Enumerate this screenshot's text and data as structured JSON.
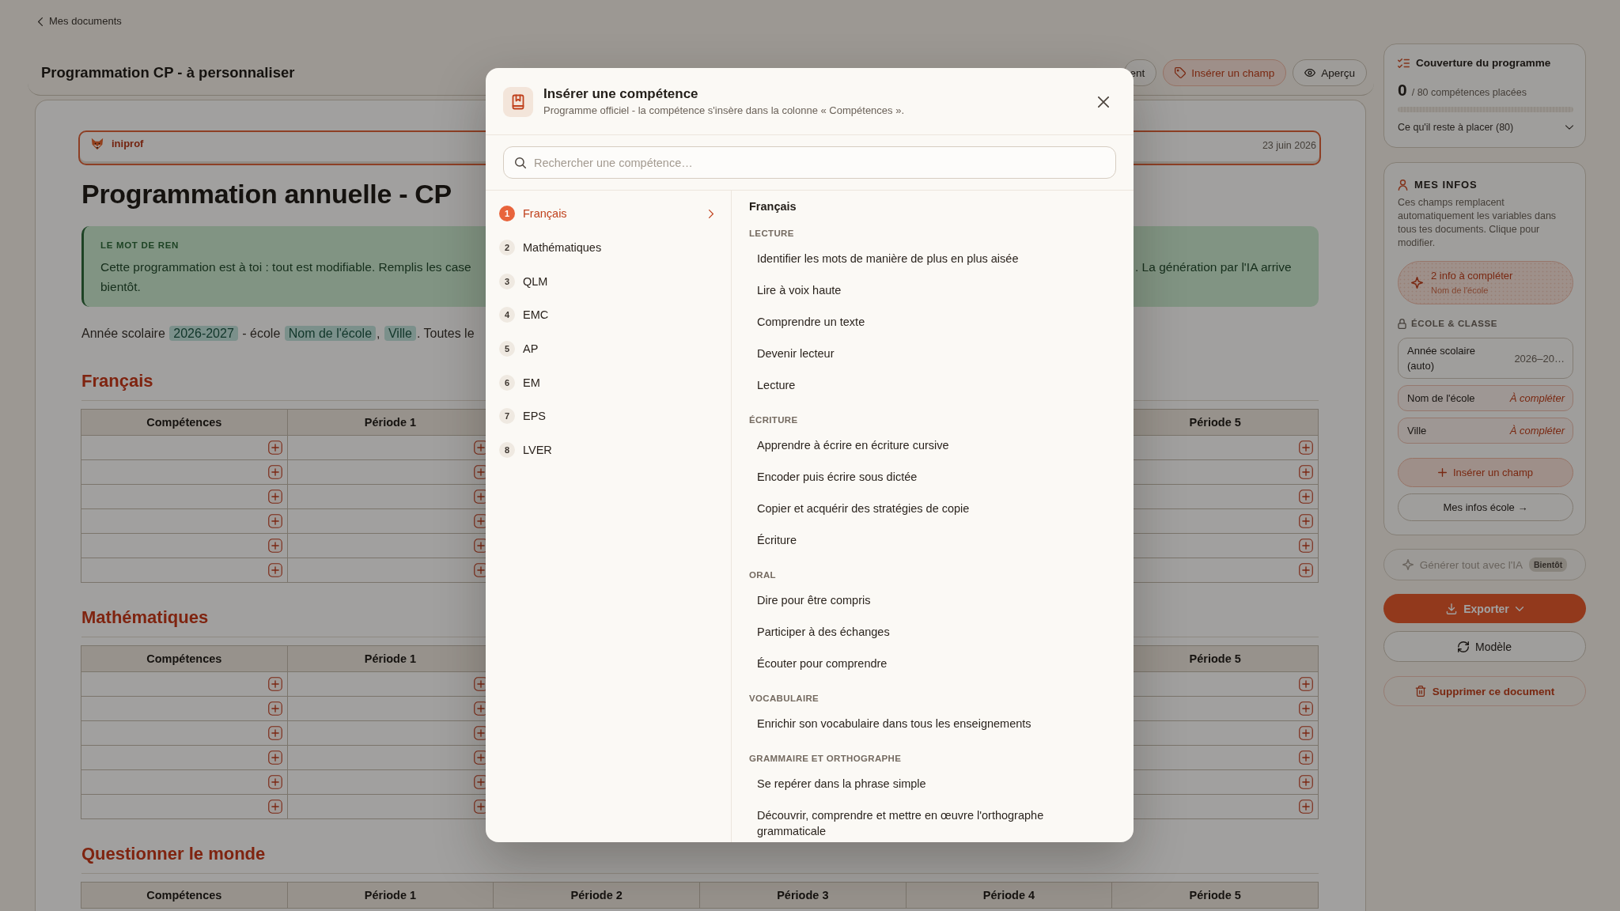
{
  "back_link": "Mes documents",
  "header": {
    "title": "Programmation CP - à personnaliser",
    "buttons": [
      {
        "label": "ent",
        "kind": "outline"
      },
      {
        "label": "Insérer un champ",
        "kind": "accent"
      },
      {
        "label": "Aperçu",
        "kind": "outline"
      }
    ]
  },
  "document": {
    "brand": "iniprof",
    "date": "23 juin 2026",
    "title": "Programmation annuelle - CP",
    "callout": {
      "label": "LE MOT DE REN",
      "text_lines": [
        "Cette programmation est à toi : tout est modifiable. Remplis les case",
        "bientôt."
      ],
      "text_past_dialog": ". La génération par l'IA arrive"
    },
    "intro": [
      {
        "kind": "text",
        "text": "Année scolaire "
      },
      {
        "kind": "variable",
        "text": "2026-2027"
      },
      {
        "kind": "text",
        "text": " - école "
      },
      {
        "kind": "variable",
        "text": "Nom de l'école"
      },
      {
        "kind": "text",
        "text": ", "
      },
      {
        "kind": "variable",
        "text": "Ville"
      },
      {
        "kind": "text",
        "text": ". Toutes le"
      }
    ],
    "sections": [
      {
        "title": "Français",
        "columns": [
          "Compétences",
          "Période 1"
        ],
        "columns_past_dialog": [
          "Période 5"
        ],
        "rows": [
          {},
          {},
          {},
          {},
          {},
          {}
        ]
      },
      {
        "title": "Mathématiques",
        "columns": [
          "Compétences",
          "Période 1"
        ],
        "columns_past_dialog": [
          "Période 5"
        ],
        "rows": [
          {},
          {},
          {},
          {},
          {},
          {}
        ]
      },
      {
        "title": "Questionner le monde",
        "columns": [
          "Compétences",
          "Période 1",
          "Période 2",
          "Période 3",
          "Période 4",
          "Période 5"
        ]
      }
    ]
  },
  "dialog": {
    "title": "Insérer une compétence",
    "subtitle": "Programme officiel - la compétence s'insère dans la colonne « Compétences ».",
    "search": {
      "placeholder": "Rechercher une compétence…"
    },
    "subjects": [
      {
        "number": "1",
        "label": "Français",
        "selected": true
      },
      {
        "number": "2",
        "label": "Mathématiques",
        "selected": false
      },
      {
        "number": "3",
        "label": "QLM",
        "selected": false
      },
      {
        "number": "4",
        "label": "EMC",
        "selected": false
      },
      {
        "number": "5",
        "label": "AP",
        "selected": false
      },
      {
        "number": "6",
        "label": "EM",
        "selected": false
      },
      {
        "number": "7",
        "label": "EPS",
        "selected": false
      },
      {
        "number": "8",
        "label": "LVER",
        "selected": false
      }
    ],
    "heading": "Français",
    "groups": [
      {
        "title": "LECTURE",
        "items": [
          "Identifier les mots de manière de plus en plus aisée",
          "Lire à voix haute",
          "Comprendre un texte",
          "Devenir lecteur",
          "Lecture"
        ]
      },
      {
        "title": "ÉCRITURE",
        "items": [
          "Apprendre à écrire en écriture cursive",
          "Encoder puis écrire sous dictée",
          "Copier et acquérir des stratégies de copie",
          "Écriture"
        ]
      },
      {
        "title": "ORAL",
        "items": [
          "Dire pour être compris",
          "Participer à des échanges",
          "Écouter pour comprendre"
        ]
      },
      {
        "title": "VOCABULAIRE",
        "items": [
          "Enrichir son vocabulaire dans tous les enseignements"
        ]
      },
      {
        "title": "GRAMMAIRE ET ORTHOGRAPHE",
        "items": [
          "Se repérer dans la phrase simple",
          "Découvrir, comprendre et mettre en œuvre l'orthographe grammaticale"
        ]
      }
    ]
  },
  "sidebar": {
    "coverage": {
      "title": "Couverture du programme",
      "count": "0",
      "count_label": "/ 80 compétences placées",
      "level": 0,
      "remaining": "Ce qu'il reste à placer (80)",
      "expanded": false
    },
    "my_info": {
      "title": "MES INFOS",
      "description": "Ces champs remplacent automatiquement les variables dans tous tes documents. Clique pour modifier.",
      "alert": {
        "title": "2 info à compléter",
        "detail": "Nom de l'école"
      },
      "group": "ÉCOLE & CLASSE",
      "fields": [
        {
          "label": "Année scolaire (auto)",
          "value": "2026–20…",
          "missing": false
        },
        {
          "label": "Nom de l'école",
          "value": "À compléter",
          "missing": true
        },
        {
          "label": "Ville",
          "value": "À compléter",
          "missing": true
        }
      ],
      "buttons": [
        {
          "label": "Insérer un champ",
          "kind": "accent"
        },
        {
          "label": "Mes infos école →",
          "kind": "outline"
        }
      ]
    },
    "generate": {
      "label": "Générer tout avec l'IA",
      "badge": "Bientôt",
      "disabled": true
    },
    "actions": [
      {
        "label": "Exporter",
        "kind": "primary"
      },
      {
        "label": "Modèle",
        "kind": "outline"
      },
      {
        "label": "Supprimer ce document",
        "kind": "danger"
      }
    ]
  }
}
